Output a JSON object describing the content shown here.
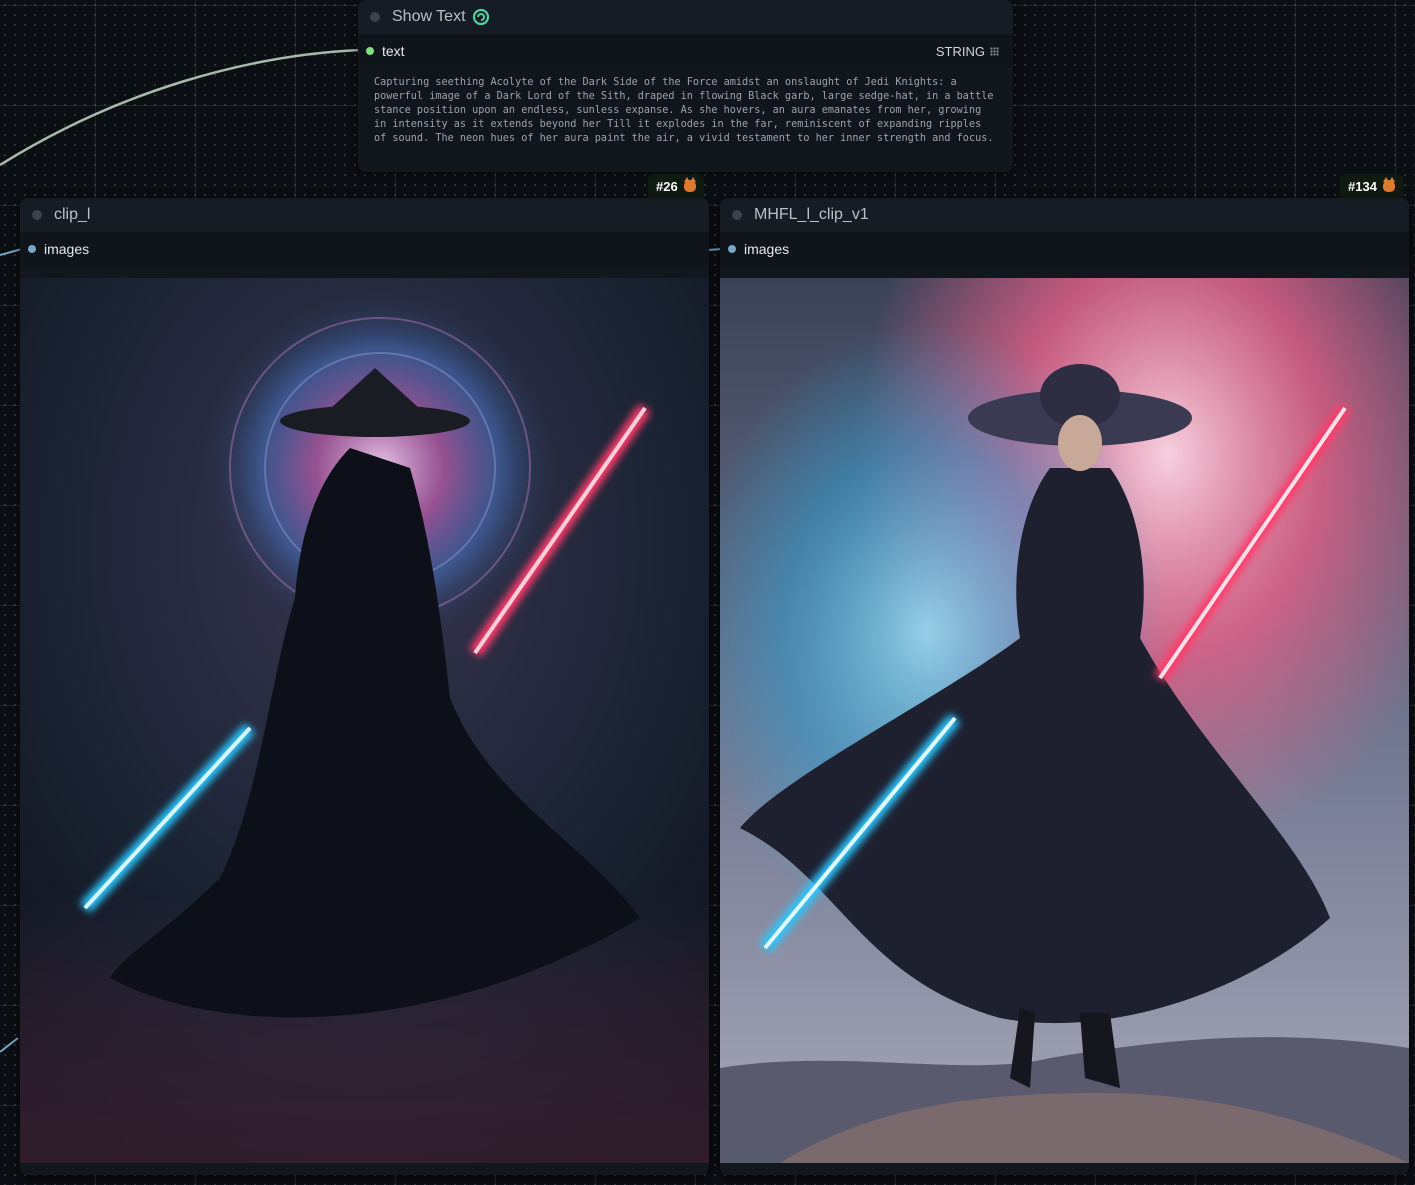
{
  "show_text_node": {
    "title": "Show Text",
    "brand_icon": "pysssss-snake-icon",
    "slot_label": "text",
    "slot_type": "STRING",
    "text_value": "Capturing seething Acolyte of the Dark Side of the Force amidst an onslaught of Jedi Knights: a powerful image of a Dark Lord of the Sith, draped in flowing Black garb, large sedge-hat, in a battle stance position upon an endless, sunless expanse. As she hovers, an aura emanates from her, growing in intensity as it extends beyond her Till it explodes in the far, reminiscent of expanding ripples of sound. The neon hues of her aura paint the air, a vivid testament to her inner strength and focus."
  },
  "left_node": {
    "badge": "#26",
    "title": "clip_l",
    "slot_label": "images",
    "image": "Dark cloaked figure in conical straw hat holding red and blue lightsabers before a glowing pink and blue energy ring"
  },
  "right_node": {
    "badge": "#134",
    "title": "MHFL_l_clip_v1",
    "slot_label": "images",
    "image": "Woman in wide-brimmed hat and flowing dark dress holding blue and red lightsabers amid pink and blue smoke on a hilltop"
  },
  "colors": {
    "wire": "#a8b8ac",
    "slot_string": "#7ee07e",
    "slot_image": "#7aa7c9",
    "badge_bg": "#0f1a10"
  }
}
